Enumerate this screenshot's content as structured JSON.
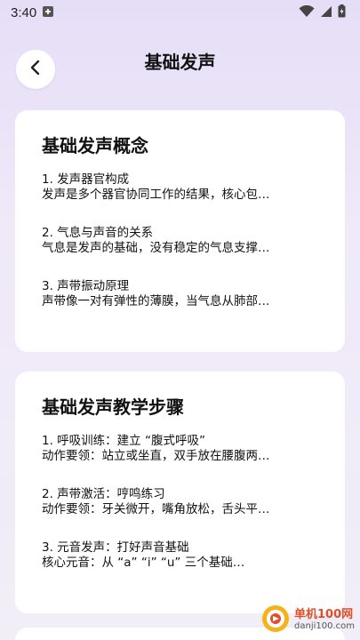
{
  "status_bar": {
    "time": "3:40",
    "icons": [
      "notification-icon",
      "wifi-icon",
      "signal-icon",
      "battery-icon"
    ]
  },
  "header": {
    "title": "基础发声",
    "back_icon": "chevron-left-icon"
  },
  "cards": [
    {
      "title": "基础发声概念",
      "items": [
        {
          "head": "1. 发声器官构成",
          "body": "发声是多个器官协同工作的结果，核心包…"
        },
        {
          "head": "2. 气息与声音的关系",
          "body": "气息是发声的基础，没有稳定的气息支撑…"
        },
        {
          "head": "3. 声带振动原理",
          "body": "声带像一对有弹性的薄膜，当气息从肺部…"
        }
      ]
    },
    {
      "title": "基础发声教学步骤",
      "items": [
        {
          "head": "1. 呼吸训练：建立 “腹式呼吸”",
          "body": "动作要领：站立或坐直，双手放在腰腹两…"
        },
        {
          "head": "2. 声带激活：哼鸣练习",
          "body": "动作要领：牙关微开，嘴角放松，舌头平…"
        },
        {
          "head": "3. 元音发声：打好声音基础",
          "body": "核心元音：从 “a” “i” “u” 三个基础…"
        }
      ]
    }
  ],
  "watermark": {
    "name": "单机100网",
    "url": "danji100.com"
  },
  "colors": {
    "accent": "#e04f2a",
    "background_top": "#e6def7",
    "card": "#ffffff"
  }
}
